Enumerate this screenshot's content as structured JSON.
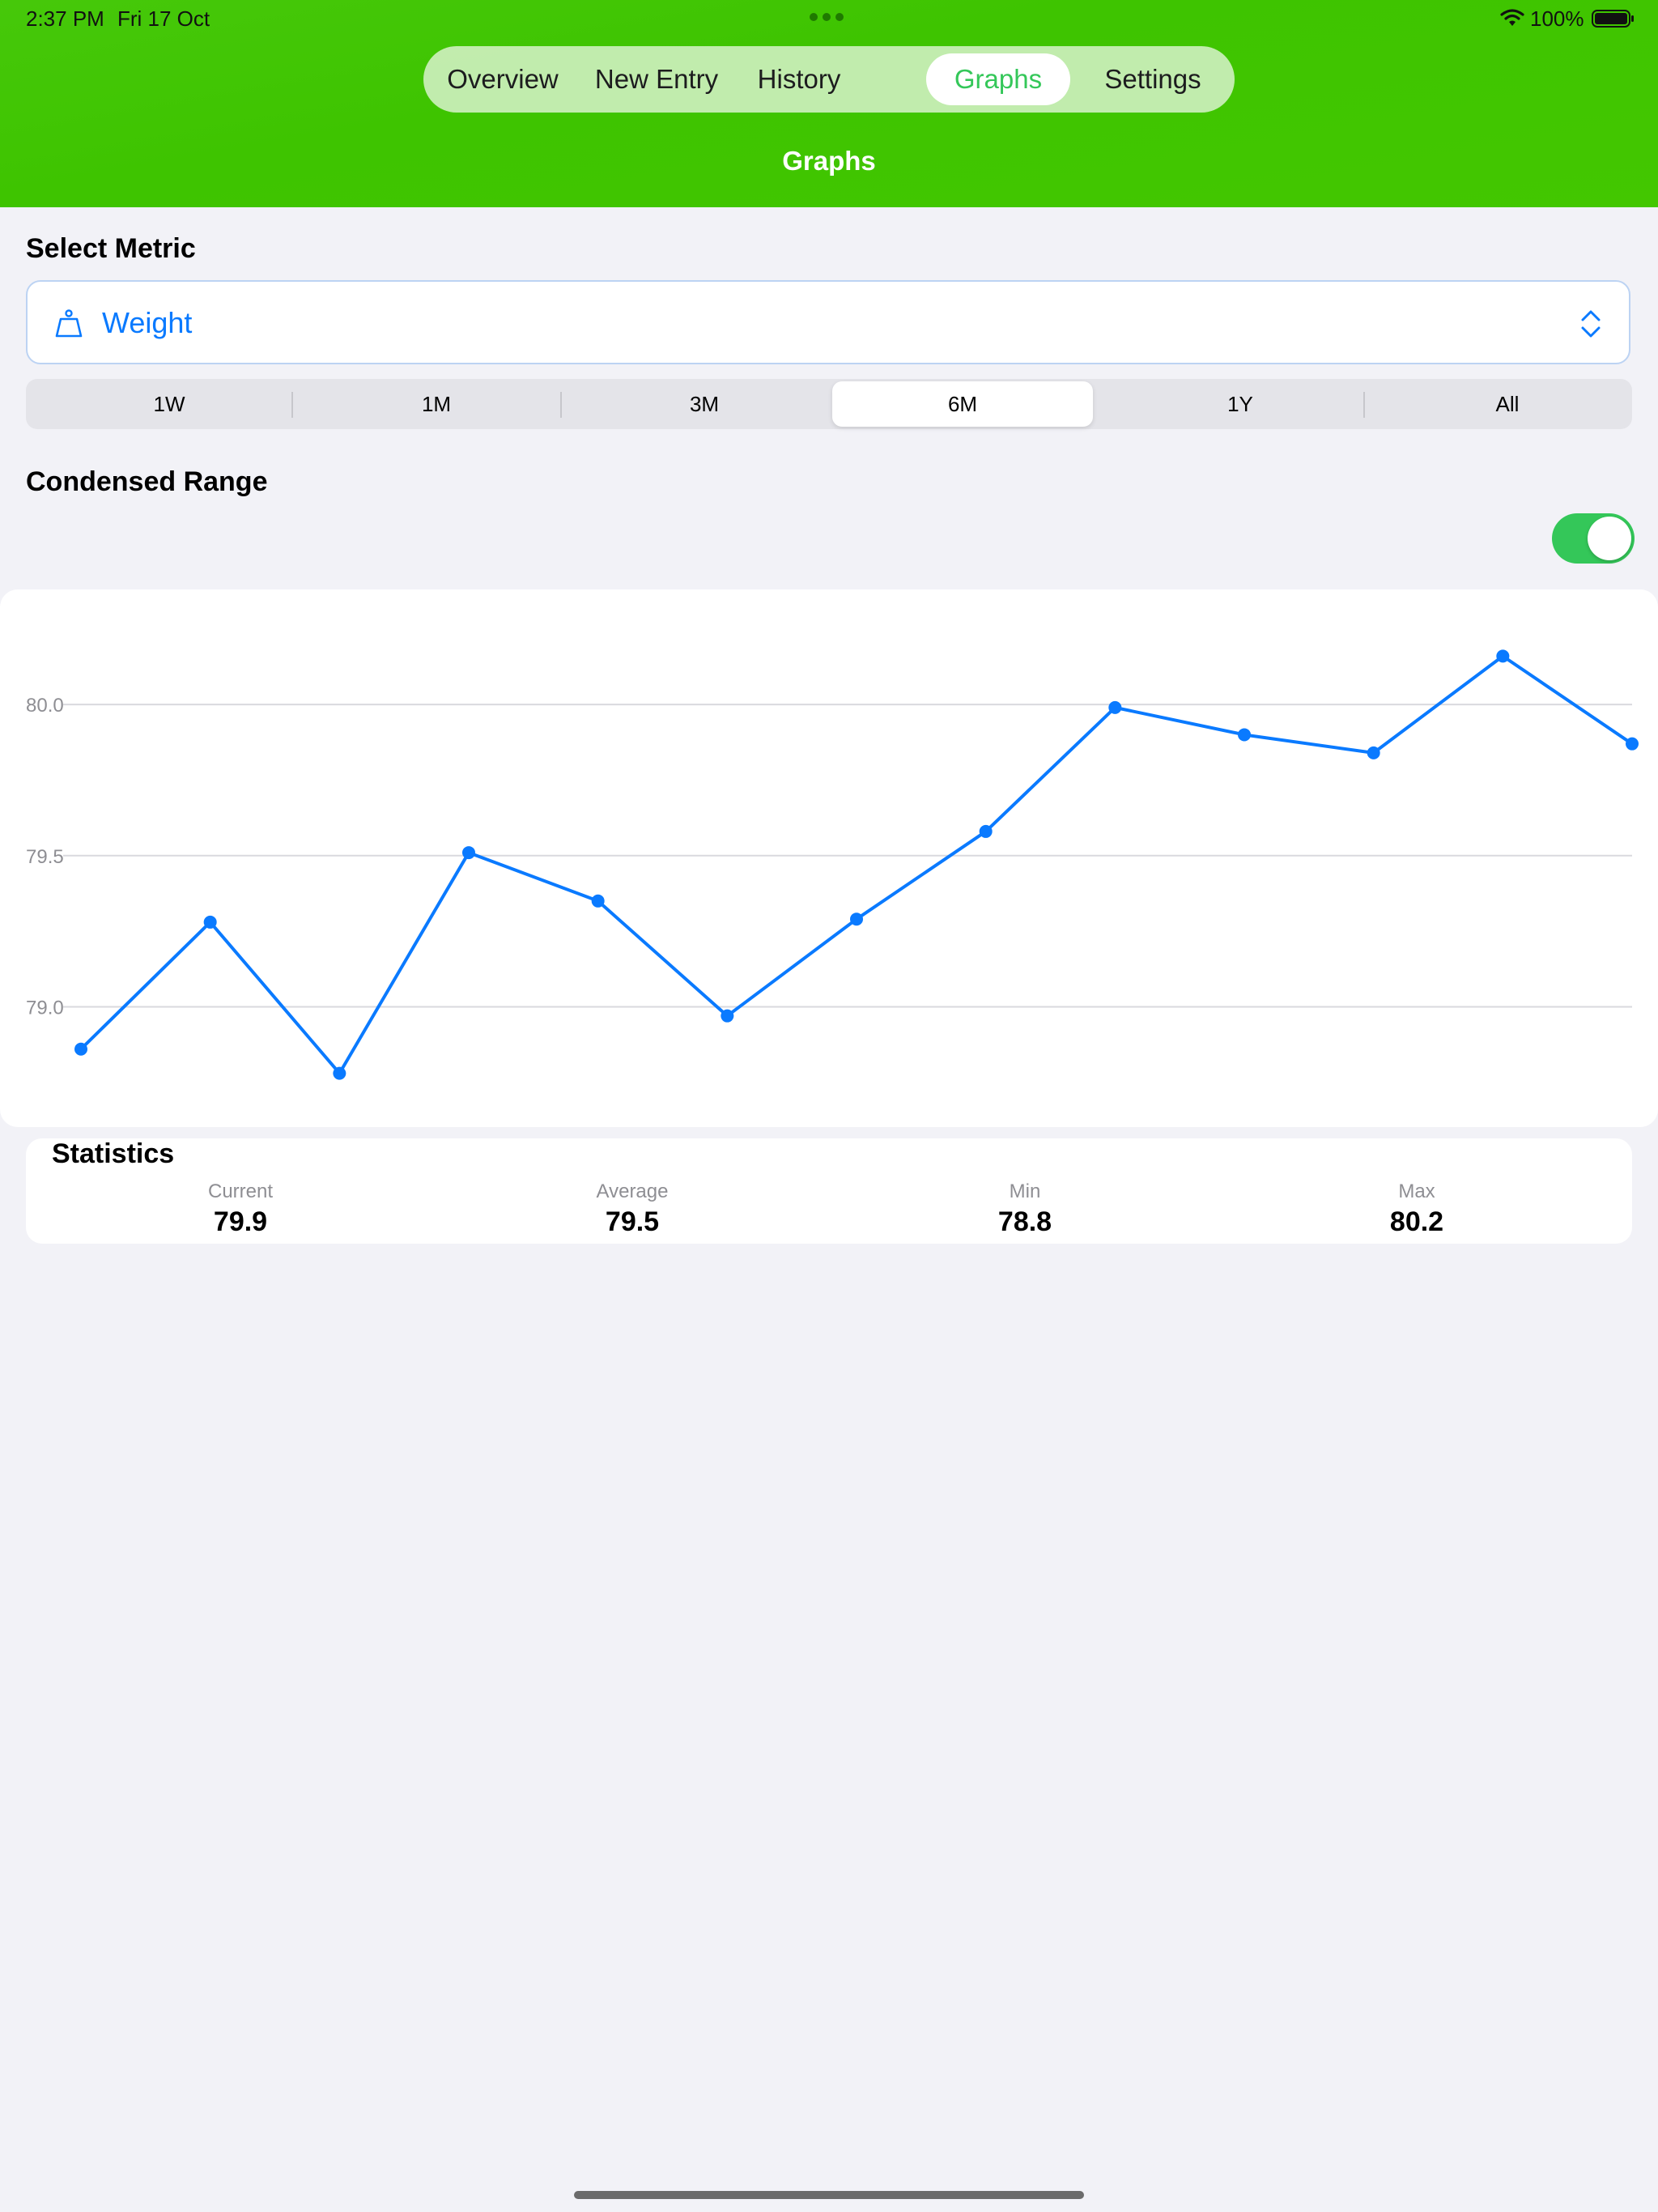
{
  "status_bar": {
    "time": "2:37 PM",
    "date": "Fri 17 Oct",
    "battery": "100%"
  },
  "tabs": [
    {
      "label": "Overview",
      "active": false
    },
    {
      "label": "New Entry",
      "active": false
    },
    {
      "label": "History",
      "active": false
    },
    {
      "label": "Graphs",
      "active": true
    },
    {
      "label": "Settings",
      "active": false
    }
  ],
  "nav_title": "Graphs",
  "select_metric": {
    "label": "Select Metric",
    "value": "Weight",
    "icon": "scale-icon"
  },
  "ranges": [
    {
      "label": "1W",
      "active": false
    },
    {
      "label": "1M",
      "active": false
    },
    {
      "label": "3M",
      "active": false
    },
    {
      "label": "6M",
      "active": true
    },
    {
      "label": "1Y",
      "active": false
    },
    {
      "label": "All",
      "active": false
    }
  ],
  "condensed_range": {
    "label": "Condensed Range",
    "on": true
  },
  "colors": {
    "accent_green": "#34c759",
    "header_green": "#3ec400",
    "line_blue": "#0a7aff"
  },
  "chart_data": {
    "type": "line",
    "y_ticks": [
      "79.0",
      "79.5",
      "80.0"
    ],
    "ylim": [
      78.72,
      80.22
    ],
    "series": [
      {
        "values": [
          78.86,
          79.28,
          78.78,
          79.51,
          79.35,
          78.97,
          79.29,
          79.58,
          79.99,
          79.9,
          79.84,
          80.16,
          79.87
        ]
      }
    ]
  },
  "statistics": {
    "title": "Statistics",
    "items": [
      {
        "label": "Current",
        "value": "79.9"
      },
      {
        "label": "Average",
        "value": "79.5"
      },
      {
        "label": "Min",
        "value": "78.8"
      },
      {
        "label": "Max",
        "value": "80.2"
      }
    ]
  }
}
